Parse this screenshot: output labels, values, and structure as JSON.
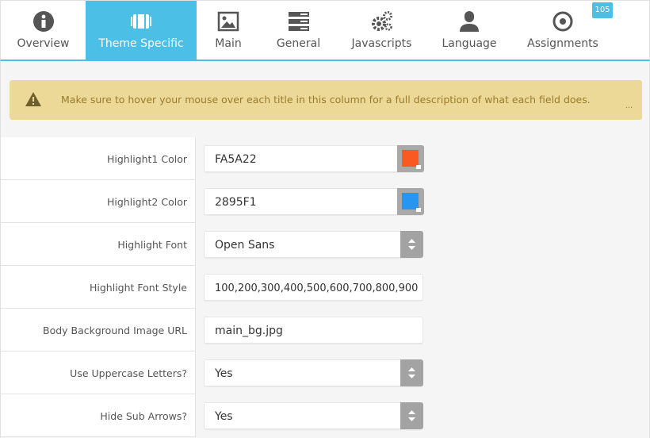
{
  "tabs": [
    {
      "label": "Overview",
      "icon": "info-icon",
      "active": false
    },
    {
      "label": "Theme Specific",
      "icon": "theme-icon",
      "active": true
    },
    {
      "label": "Main",
      "icon": "image-icon",
      "active": false
    },
    {
      "label": "General",
      "icon": "list-icon",
      "active": false
    },
    {
      "label": "Javascripts",
      "icon": "gears-icon",
      "active": false
    },
    {
      "label": "Language",
      "icon": "user-icon",
      "active": false
    },
    {
      "label": "Assignments",
      "icon": "target-icon",
      "active": false
    }
  ],
  "badge": "105",
  "alert": {
    "message": "Make sure to hover your mouse over each title in this column for a full description of what each field does.",
    "more": "..."
  },
  "fields": [
    {
      "label": "Highlight1 Color",
      "value": "FA5A22",
      "type": "color",
      "color": "#FA5A22"
    },
    {
      "label": "Highlight2 Color",
      "value": "2895F1",
      "type": "color",
      "color": "#2895F1"
    },
    {
      "label": "Highlight Font",
      "value": "Open Sans",
      "type": "select"
    },
    {
      "label": "Highlight Font Style",
      "value": "100,200,300,400,500,600,700,800,900",
      "type": "text"
    },
    {
      "label": "Body Background Image URL",
      "value": "main_bg.jpg",
      "type": "text"
    },
    {
      "label": "Use Uppercase Letters?",
      "value": "Yes",
      "type": "select"
    },
    {
      "label": "Hide Sub Arrows?",
      "value": "Yes",
      "type": "select"
    }
  ],
  "colors": {
    "accent": "#4cbfe6",
    "alert_bg": "#ecd998",
    "alert_text": "#9a7b2a"
  }
}
